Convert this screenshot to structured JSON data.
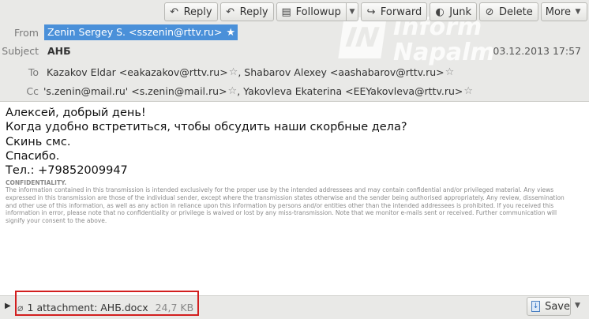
{
  "toolbar": {
    "reply": "Reply",
    "reply_all": "Reply",
    "followup": "Followup",
    "forward": "Forward",
    "junk": "Junk",
    "delete": "Delete",
    "more": "More"
  },
  "header": {
    "from_label": "From",
    "from_value": "Zenin Sergey S. <sszenin@rttv.ru>",
    "subject_label": "Subject",
    "subject_value": "АНБ",
    "date": "03.12.2013 17:57",
    "to_label": "To",
    "to_1": "Kazakov Eldar <eakazakov@rttv.ru>",
    "to_2": "Shabarov Alexey <aashabarov@rttv.ru>",
    "cc_label": "Cc",
    "cc_1": "'s.zenin@mail.ru' <s.zenin@mail.ru>",
    "cc_2": "Yakovleva Ekaterina <EEYakovleva@rttv.ru>"
  },
  "watermark": {
    "badge": "IN",
    "line1": "Inform",
    "line2": "Napalm"
  },
  "body": {
    "lines": [
      "Алексей, добрый день!",
      "Когда удобно встретиться, чтобы обсудить наши скорбные дела?",
      "Скинь смс.",
      "Спасибо.",
      "Тел.: +79852009947"
    ],
    "confidentiality_title": "CONFIDENTIALITY.",
    "confidentiality_text": "The information contained in this transmission is intended exclusively for the proper use by the intended addressees and may contain confidential and/or privileged material. Any views expressed in this transmission are those of the individual sender, except where the transmission states otherwise and the sender being authorised appropriately. Any review, dissemination and other use of this information, as well as any action in reliance upon this information by persons and/or entities other than the intended addressees is prohibited. If you received this information in error, please note that no confidentiality or privilege is waived or lost by any miss-transmission. Note that we monitor e-mails sent or received. Further communication will signify your consent to the above."
  },
  "attachments": {
    "summary": "1 attachment: АНБ.docx",
    "size": "24,7 KB",
    "save": "Save"
  },
  "colors": {
    "header_bg": "#e9e9e7",
    "selection": "#4a90d9",
    "highlight_box": "#d21f1f"
  }
}
